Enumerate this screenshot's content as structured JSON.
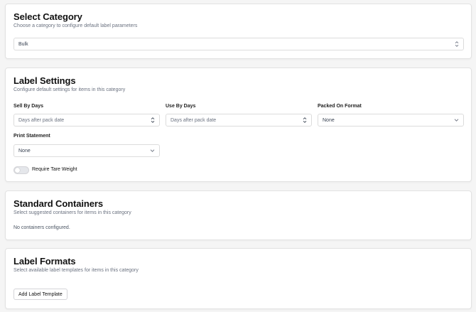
{
  "select_category": {
    "title": "Select Category",
    "subtitle": "Choose a category to configure default label parameters",
    "selected": "Bulk"
  },
  "label_settings": {
    "title": "Label Settings",
    "subtitle": "Configure default settings for items in this category",
    "sell_by": {
      "label": "Sell By Days",
      "placeholder": "Days after pack date"
    },
    "use_by": {
      "label": "Use By Days",
      "placeholder": "Days after pack date"
    },
    "packed_on": {
      "label": "Packed On Format",
      "value": "None"
    },
    "print_statement": {
      "label": "Print Statement",
      "value": "None"
    },
    "tare_toggle": {
      "label": "Require Tare Weight",
      "checked": false
    }
  },
  "standard_containers": {
    "title": "Standard Containers",
    "subtitle": "Select suggested containers for items in this category",
    "empty": "No containers configured."
  },
  "label_formats": {
    "title": "Label Formats",
    "subtitle": "Select available label templates for items in this category",
    "add_button": "Add Label Template"
  },
  "icons": {
    "updown": "chevrons-up-down-icon",
    "down": "chevron-down-icon"
  }
}
